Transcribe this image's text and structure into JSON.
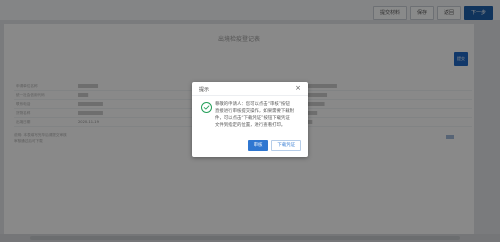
{
  "toolbar": {
    "buttons": [
      "提交材料",
      "保存",
      "返回",
      "下一步"
    ]
  },
  "sheet": {
    "title": "出境检疫登记表",
    "side_badge": "提交"
  },
  "form": {
    "rows": [
      [
        {
          "label": "申请单位名称",
          "value": "████████"
        },
        {
          "label": "申请单位地址",
          "value": "████████████"
        }
      ],
      [
        {
          "label": "统一社会信用代码",
          "value": "████"
        },
        {
          "label": "申请单位联系人",
          "value": "████████"
        }
      ],
      [
        {
          "label": "联系电话",
          "value": "██████████"
        },
        {
          "label": "手机号码",
          "value": "███████"
        }
      ],
      [
        {
          "label": "货物名称",
          "value": "██████████"
        },
        {
          "label": "出境口岸",
          "value": "████"
        }
      ],
      [
        {
          "label": "出境日期",
          "value": "2020-11-19"
        },
        {
          "label": "运输方式",
          "value": "██"
        }
      ]
    ],
    "notes": [
      "说明:  本表填写完毕后请提交审核",
      "           审核通过后可下载"
    ]
  },
  "dialog": {
    "title": "提示",
    "close": "×",
    "message": [
      "尊敬的申请人：您可以点击“审核”按钮",
      "直接进行审核提交操作，如果需要下载附",
      "件，可以点击“下载凭证”按钮下载凭证",
      "文件到指定的位置，进行查看打印。"
    ],
    "ok_label": "审核",
    "download_label": "下载凭证"
  },
  "icons": {
    "success": "check-circle-icon",
    "close": "close-icon"
  },
  "colors": {
    "primary": "#2f77d1",
    "success": "#25a05a",
    "overlay": "rgba(0,0,0,0.45)"
  }
}
